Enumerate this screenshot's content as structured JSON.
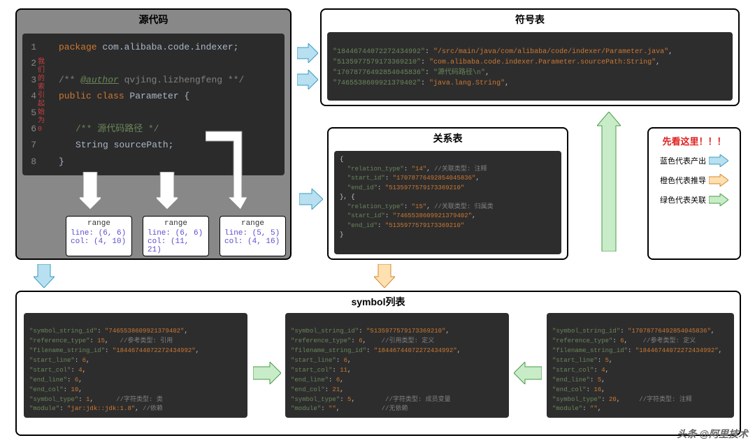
{
  "source": {
    "title": "源代码",
    "gutter_note": [
      "我",
      "们",
      "的",
      "索",
      "引",
      "起",
      "始",
      "为",
      "0"
    ],
    "lines": {
      "l1_kw": "package",
      "l1_rest": " com.alibaba.code.indexer;",
      "l3_open": "/** ",
      "l3_ann": "@author",
      "l3_rest": " qvjing.lizhengfeng **/",
      "l4_kw1": "public",
      "l4_kw2": " class",
      "l4_ident": " Parameter",
      "l4_brace": " {",
      "l6_cmt": "/** 源代码路径 */",
      "l7_type": "String",
      "l7_name": " sourcePath;",
      "l8": "}"
    },
    "ranges": [
      {
        "label": "range",
        "line": "line: (6, 6)",
        "col": "col: (4, 10)"
      },
      {
        "label": "range",
        "line": "line: (6, 6)",
        "col": "col: (11, 21)"
      },
      {
        "label": "range",
        "line": "line: (5, 5)",
        "col": "col: (4, 16)"
      }
    ]
  },
  "symbols": {
    "title": "符号表",
    "rows": [
      {
        "k": "\"18446744072272434992\"",
        "v": "\"/src/main/java/com/alibaba/code/indexer/Parameter.java\""
      },
      {
        "k": "\"5135977579173369210\"",
        "v": "\"com.alibaba.code.indexer.Parameter.sourcePath:String\""
      },
      {
        "k": "\"17078776492854045836\"",
        "v": "\"源代码路径\\n\""
      },
      {
        "k": "\"7465538609921379402\"",
        "v": "\"java.lang.String\""
      }
    ]
  },
  "relation": {
    "title": "关系表",
    "r1": {
      "type": "\"14\"",
      "type_cmt": "//关联类型: 注释",
      "start": "\"17078776492854045836\"",
      "end": "\"5135977579173369210\""
    },
    "r2": {
      "type": "\"15\"",
      "type_cmt": "//关联类型: 归属类",
      "start": "\"7465538609921379402\"",
      "end": "\"5135977579173369210\""
    }
  },
  "legend": {
    "title": "先看这里！！！",
    "blue": "蓝色代表产出",
    "orange": "橙色代表推导",
    "green": "绿色代表关联"
  },
  "symbol_list": {
    "title": "symbol列表",
    "cards": [
      {
        "symbol_string_id": "\"7465538609921379402\"",
        "reference_type": "15",
        "ref_cmt": "//参考类型: 引用",
        "filename_string_id": "\"18446744072272434992\"",
        "start_line": "6",
        "start_col": "4",
        "end_line": "6",
        "end_col": "10",
        "symbol_type": "1",
        "sym_cmt": "//字符类型: 类",
        "module": "\"jar:jdk::jdk:1.8\"",
        "mod_cmt": "//依赖"
      },
      {
        "symbol_string_id": "\"5135977579173369210\"",
        "reference_type": "6",
        "ref_cmt": "//引用类型: 定义",
        "filename_string_id": "\"18446744072272434992\"",
        "start_line": "6",
        "start_col": "11",
        "end_line": "6",
        "end_col": "21",
        "symbol_type": "5",
        "sym_cmt": "//字符类型: 成员变量",
        "module": "\"\"",
        "mod_cmt": "//无依赖"
      },
      {
        "symbol_string_id": "\"17078776492854045836\"",
        "reference_type": "6",
        "ref_cmt": "//参考类型: 定义",
        "filename_string_id": "\"18446744072272434992\"",
        "start_line": "5",
        "start_col": "4",
        "end_line": "5",
        "end_col": "16",
        "symbol_type": "20",
        "sym_cmt": "//字符类型: 注释",
        "module": "\"\"",
        "mod_cmt": ""
      }
    ]
  },
  "watermark": "头条 @阿里技术"
}
